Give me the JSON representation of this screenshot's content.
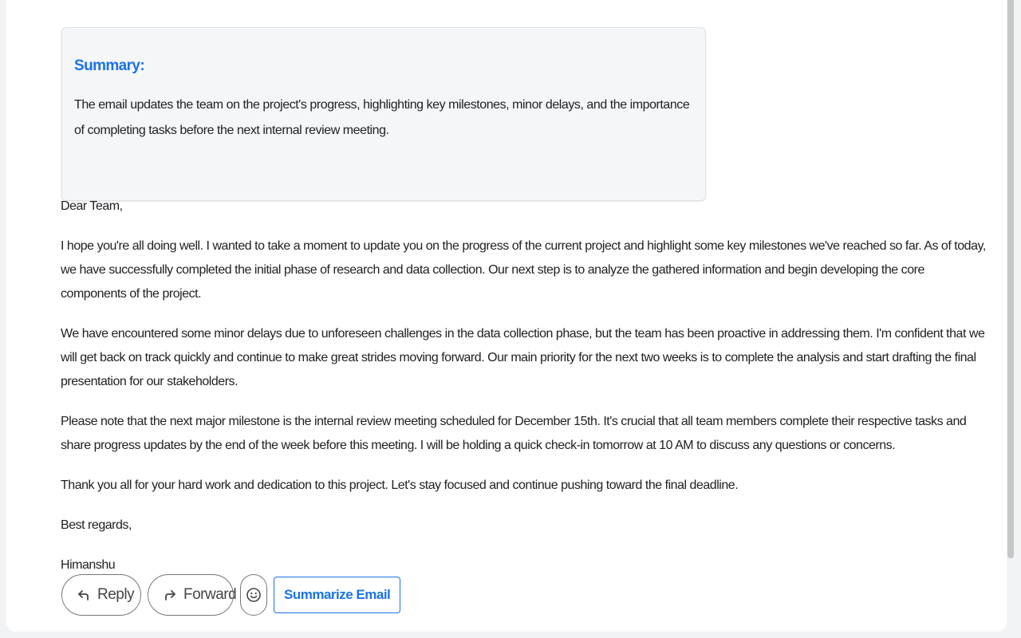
{
  "summary": {
    "title": "Summary:",
    "text": "The email updates the team on the project's progress, highlighting key milestones, minor delays, and the importance of completing tasks before the next internal review meeting."
  },
  "email": {
    "greeting": "Dear Team,",
    "paragraphs": [
      "I hope you're all doing well. I wanted to take a moment to update you on the progress of the current project and highlight some key milestones we've reached so far. As of today, we have successfully completed the initial phase of research and data collection. Our next step is to analyze the gathered information and begin developing the core components of the project.",
      "We have encountered some minor delays due to unforeseen challenges in the data collection phase, but the team has been proactive in addressing them. I'm confident that we will get back on track quickly and continue to make great strides moving forward. Our main priority for the next two weeks is to complete the analysis and start drafting the final presentation for our stakeholders.",
      "Please note that the next major milestone is the internal review meeting scheduled for December 15th. It's crucial that all team members complete their respective tasks and share progress updates by the end of the week before this meeting. I will be holding a quick check-in tomorrow at 10 AM to discuss any questions or concerns.",
      "Thank you all for your hard work and dedication to this project. Let's stay focused and continue pushing toward the final deadline."
    ],
    "closing": "Best regards,",
    "signature": "Himanshu"
  },
  "actions": {
    "reply_label": "Reply",
    "reply_icon": "reply-icon",
    "forward_label": "Forward",
    "forward_icon": "forward-icon",
    "emoji_icon": "smiley-icon",
    "summarize_label": "Summarize Email"
  },
  "colors": {
    "accent": "#1a73e8",
    "text": "#202124",
    "summary_bg": "#f5f6f8"
  }
}
